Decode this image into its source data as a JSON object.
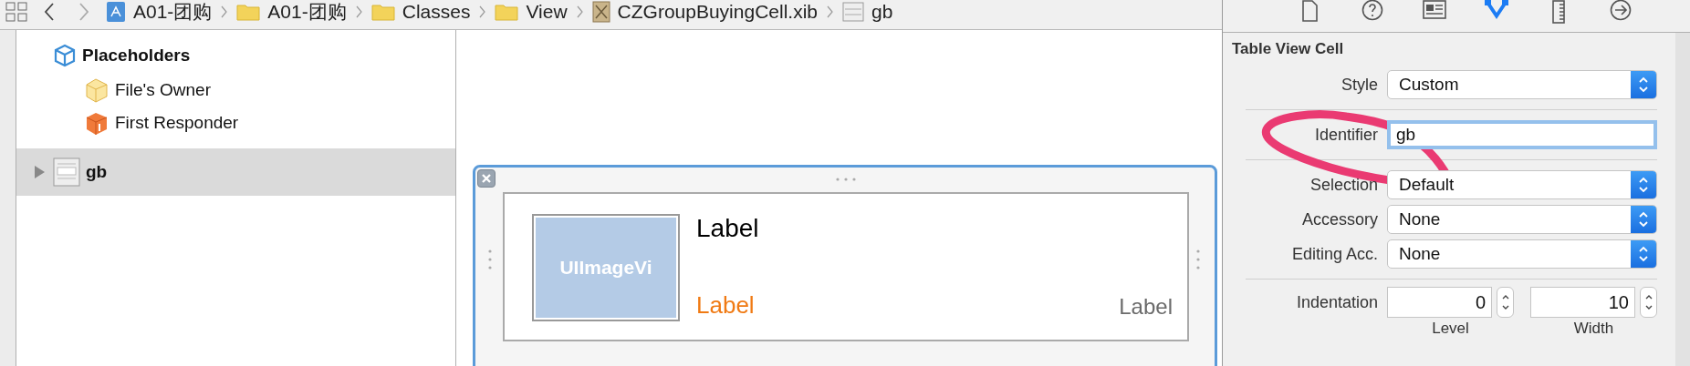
{
  "breadcrumbs": [
    {
      "label": "A01-团购",
      "kind": "project"
    },
    {
      "label": "A01-团购",
      "kind": "folder"
    },
    {
      "label": "Classes",
      "kind": "folder"
    },
    {
      "label": "View",
      "kind": "folder"
    },
    {
      "label": "CZGroupBuyingCell.xib",
      "kind": "xib"
    },
    {
      "label": "gb",
      "kind": "cell"
    }
  ],
  "inspector_tabs": [
    {
      "kind": "file",
      "selected": false
    },
    {
      "kind": "help",
      "selected": false
    },
    {
      "kind": "identity",
      "selected": false
    },
    {
      "kind": "attributes",
      "selected": true
    },
    {
      "kind": "size",
      "selected": false
    },
    {
      "kind": "connections",
      "selected": false
    }
  ],
  "outline": {
    "section": "Placeholders",
    "placeholders": [
      {
        "label": "File's Owner",
        "kind": "owner"
      },
      {
        "label": "First Responder",
        "kind": "responder"
      }
    ],
    "objects": [
      {
        "label": "gb",
        "expanded": false,
        "selected": true
      }
    ]
  },
  "canvas": {
    "cell": {
      "image_label": "UIImageVi",
      "title": "Label",
      "price": "Label",
      "count": "Label"
    }
  },
  "inspector": {
    "title": "Table View Cell",
    "rows": [
      {
        "kind": "popup",
        "label": "Style",
        "value": "Custom",
        "divider": true
      },
      {
        "kind": "text",
        "label": "Identifier",
        "value": "gb",
        "focused": true,
        "divider": true
      },
      {
        "kind": "popup",
        "label": "Selection",
        "value": "Default",
        "divider": false
      },
      {
        "kind": "popup",
        "label": "Accessory",
        "value": "None",
        "divider": false
      },
      {
        "kind": "popup",
        "label": "Editing Acc.",
        "value": "None",
        "divider": true
      }
    ],
    "indentation": {
      "label": "Indentation",
      "fields": [
        {
          "value": "0",
          "caption": "Level"
        },
        {
          "value": "10",
          "caption": "Width"
        }
      ]
    }
  }
}
